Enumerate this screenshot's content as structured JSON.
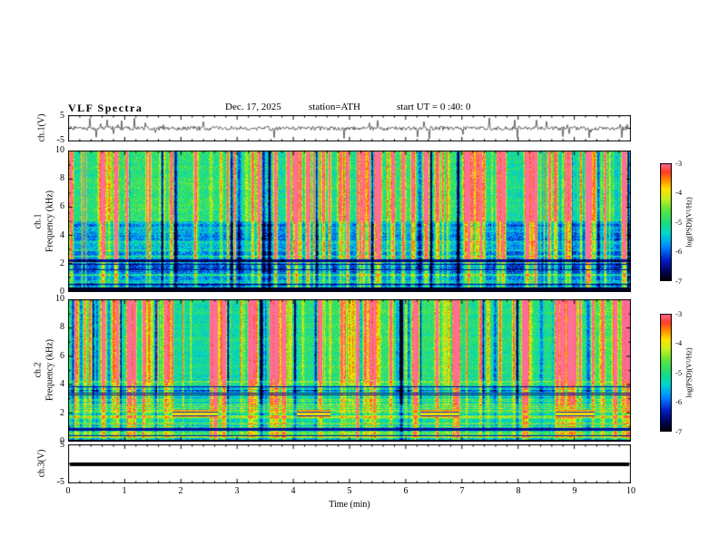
{
  "header": {
    "title": "VLF  Spectra",
    "date": "Dec. 17, 2025",
    "station": "station=ATH",
    "start_ut": "start UT =  0 :40: 0"
  },
  "xaxis": {
    "label": "Time (min)",
    "ticks": [
      "0",
      "1",
      "2",
      "3",
      "4",
      "5",
      "6",
      "7",
      "8",
      "9",
      "10"
    ]
  },
  "panels": {
    "wave1": {
      "ylabel": "ch.1(V)",
      "yticks": [
        "5",
        "-5"
      ]
    },
    "spec1": {
      "ylabel_line1": "ch.1",
      "ylabel_line2": "Frequency (kHz)",
      "yticks": [
        "10",
        "8",
        "6",
        "4",
        "2",
        "0"
      ]
    },
    "spec2": {
      "ylabel_line1": "ch.2",
      "ylabel_line2": "Frequency (kHz)",
      "yticks": [
        "10",
        "8",
        "6",
        "4",
        "2",
        "0"
      ]
    },
    "ch3": {
      "ylabel": "ch.3(V)",
      "yticks": [
        "5",
        "-5"
      ]
    }
  },
  "colorbar": {
    "label": "log(PSD)(V²/Hz)",
    "ticks": [
      "-3",
      "-4",
      "-5",
      "-6",
      "-7"
    ]
  },
  "chart_data": [
    {
      "type": "line",
      "name": "ch.1 waveform",
      "ylabel": "ch.1(V)",
      "ylim": [
        -5,
        5
      ],
      "xlim": [
        0,
        10
      ],
      "xlabel": "Time (min)",
      "description": "Broadband noise centered on 0 V with ~±1 V envelope and frequent impulsive sferic spikes reaching about ±4.5 V throughout the 10-minute record."
    },
    {
      "type": "heatmap",
      "name": "ch.1 spectrogram",
      "ylabel": "ch.1 Frequency (kHz)",
      "ylim": [
        0,
        10
      ],
      "xlim": [
        0,
        10
      ],
      "value_label": "log(PSD)(V²/Hz)",
      "value_range": [
        -7,
        -3
      ],
      "colormap": "jet (black-blue-green-yellow-red)",
      "structure": {
        "bands": [
          {
            "freq_khz": [
              0,
              0.3
            ],
            "level": "about -7, black band"
          },
          {
            "freq_khz": [
              0.3,
              2.3
            ],
            "level": "about -6.2, dark blue with horizontal interference lines"
          },
          {
            "freq_khz": [
              2.3,
              5
            ],
            "level": "about -5.9, mottled blue"
          },
          {
            "freq_khz": [
              5,
              10
            ],
            "level": "about -5.1, green background"
          }
        ],
        "vertical_streaks": "dense impulsive streaks spanning all frequencies, brightest (to about -3.5, orange/red) above 5 kHz"
      }
    },
    {
      "type": "heatmap",
      "name": "ch.2 spectrogram",
      "ylabel": "ch.2 Frequency (kHz)",
      "ylim": [
        0,
        10
      ],
      "xlim": [
        0,
        10
      ],
      "value_label": "log(PSD)(V²/Hz)",
      "value_range": [
        -7,
        -3
      ],
      "colormap": "jet (black-blue-green-yellow-red)",
      "structure": {
        "bands": [
          {
            "freq_khz": [
              0,
              0.15
            ],
            "level": "about -7, thin black band"
          },
          {
            "freq_khz": [
              0.15,
              2.6
            ],
            "level": "about -4.8, strongly striped green/yellow with dark interference lines"
          },
          {
            "freq_khz": [
              2.6,
              4.3
            ],
            "level": "about -5.0, banded green"
          },
          {
            "freq_khz": [
              4.3,
              10
            ],
            "level": "about -4.8, green with many bright and dark vertical streaks"
          }
        ],
        "event_bands": {
          "freq_khz": [
            1.7,
            2.2
          ],
          "time_ranges_min": [
            [
              1.85,
              2.65
            ],
            [
              4.05,
              4.65
            ],
            [
              6.25,
              6.95
            ],
            [
              8.65,
              9.35
            ]
          ],
          "level": "about -3.6, orange/red harmonic patches"
        }
      }
    },
    {
      "type": "line",
      "name": "ch.3 waveform",
      "ylabel": "ch.3(V)",
      "ylim": [
        -5,
        5
      ],
      "xlim": [
        0,
        10
      ],
      "description": "Constant flat thick line at 0 V (channel inactive)."
    }
  ]
}
